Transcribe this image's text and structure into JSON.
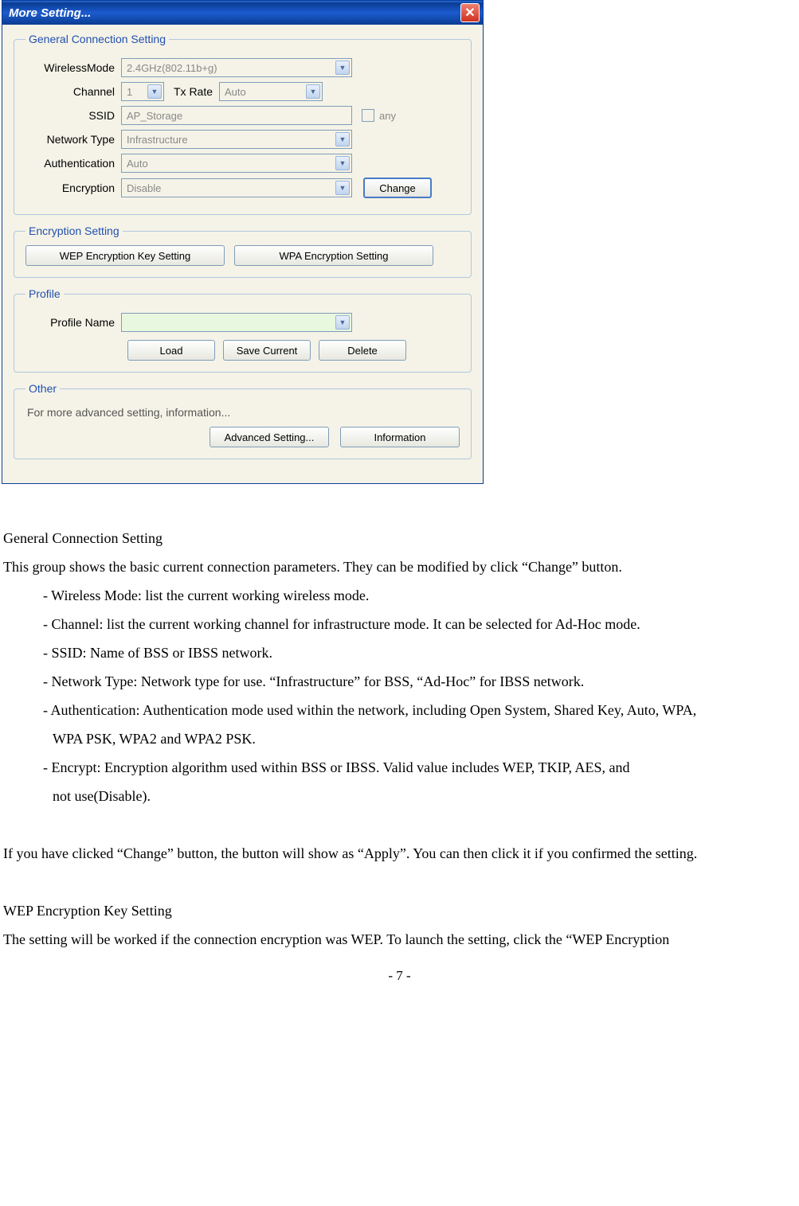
{
  "dialog": {
    "title": "More Setting...",
    "general": {
      "legend": "General Connection Setting",
      "wirelessMode": {
        "label": "WirelessMode",
        "value": "2.4GHz(802.11b+g)"
      },
      "channel": {
        "label": "Channel",
        "value": "1"
      },
      "txRate": {
        "label": "Tx Rate",
        "value": "Auto"
      },
      "ssid": {
        "label": "SSID",
        "value": "AP_Storage",
        "anyLabel": "any"
      },
      "networkType": {
        "label": "Network Type",
        "value": "Infrastructure"
      },
      "authentication": {
        "label": "Authentication",
        "value": "Auto"
      },
      "encryption": {
        "label": "Encryption",
        "value": "Disable"
      },
      "changeBtn": "Change"
    },
    "encryption": {
      "legend": "Encryption Setting",
      "wepBtn": "WEP Encryption Key Setting",
      "wpaBtn": "WPA Encryption Setting"
    },
    "profile": {
      "legend": "Profile",
      "nameLabel": "Profile Name",
      "loadBtn": "Load",
      "saveBtn": "Save Current",
      "deleteBtn": "Delete"
    },
    "other": {
      "legend": "Other",
      "text": "For more advanced setting, information...",
      "advBtn": "Advanced Setting...",
      "infoBtn": "Information"
    }
  },
  "doc": {
    "h1": "General Connection Setting",
    "p1": "This group shows the basic current connection parameters. They can be modified by click “Change” button.",
    "b1": "- Wireless Mode: list the current working wireless mode.",
    "b2": "- Channel: list the current working channel for infrastructure mode. It can be selected for Ad-Hoc mode.",
    "b3": "- SSID: Name of BSS or IBSS network.",
    "b4": "- Network Type: Network type for use. “Infrastructure” for BSS, “Ad-Hoc” for IBSS network.",
    "b5": "- Authentication: Authentication mode used within the network, including Open System, Shared Key, Auto, WPA,",
    "b5b": "WPA PSK, WPA2 and WPA2 PSK.",
    "b6": "- Encrypt: Encryption algorithm used within BSS or IBSS. Valid value includes WEP, TKIP, AES, and",
    "b6b": "not use(Disable).",
    "p2": "If you have clicked “Change” button, the button will show as “Apply”. You can then click it if you confirmed the setting.",
    "h2": "WEP Encryption Key Setting",
    "p3": "The setting will be worked if the connection encryption was WEP. To launch the setting, click the “WEP Encryption",
    "pageNum": "- 7 -"
  }
}
